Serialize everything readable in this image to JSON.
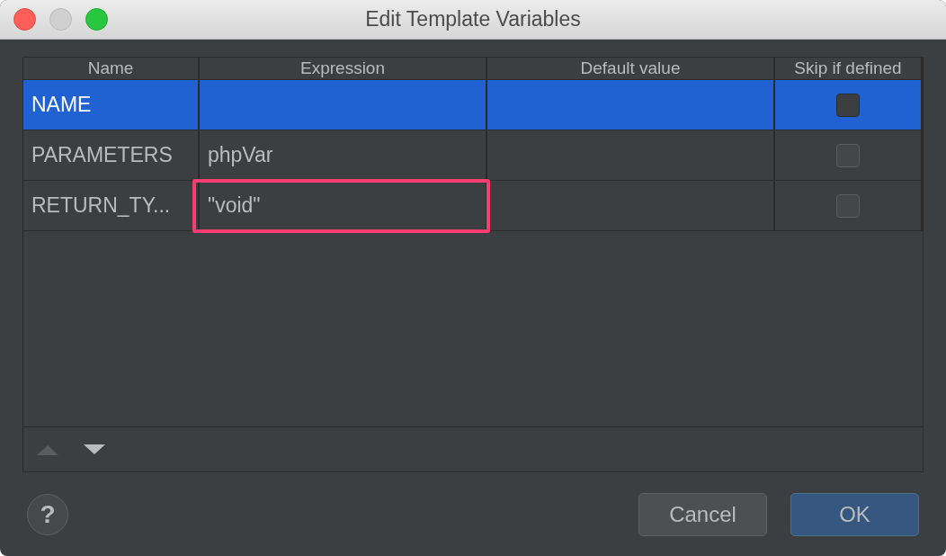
{
  "window": {
    "title": "Edit Template Variables"
  },
  "table": {
    "columns": [
      "Name",
      "Expression",
      "Default value",
      "Skip if defined"
    ],
    "rows": [
      {
        "name": "NAME",
        "expression": "",
        "default_value": "",
        "skip_if_defined": false,
        "selected": true,
        "highlighted": false
      },
      {
        "name": "PARAMETERS",
        "expression": "phpVar",
        "default_value": "",
        "skip_if_defined": false,
        "selected": false,
        "highlighted": false
      },
      {
        "name": "RETURN_TY...",
        "expression": "\"void\"",
        "default_value": "",
        "skip_if_defined": false,
        "selected": false,
        "highlighted": true
      }
    ]
  },
  "toolbar": [
    {
      "kind": "up",
      "disabled": true
    },
    {
      "kind": "down",
      "disabled": false
    }
  ],
  "buttons": [
    {
      "label": "Cancel",
      "kind": "secondary"
    },
    {
      "label": "OK",
      "kind": "primary"
    }
  ],
  "help": {
    "label": "?"
  }
}
